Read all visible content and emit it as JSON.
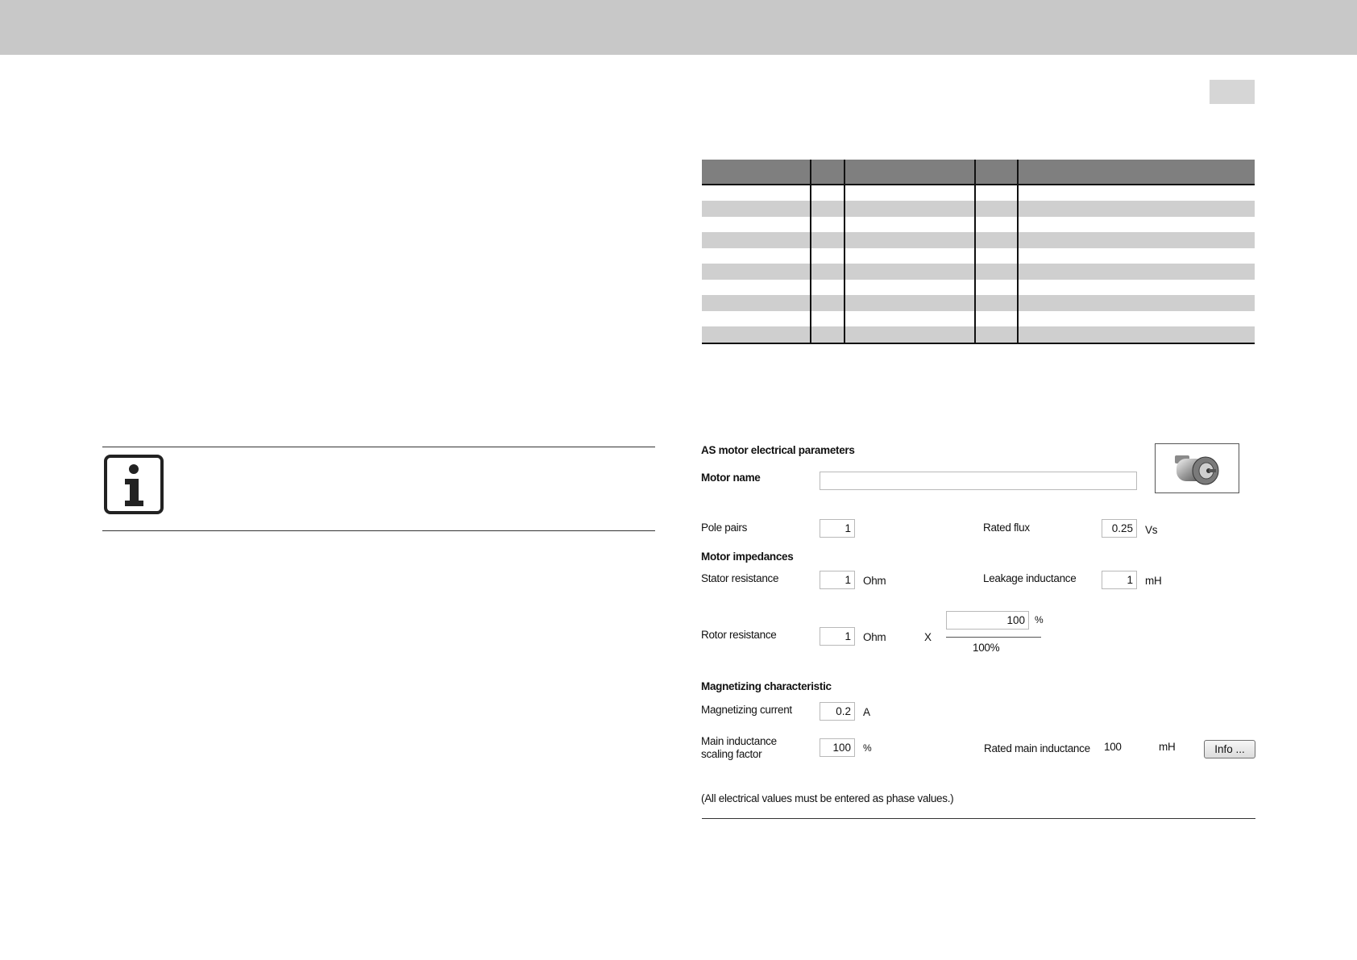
{
  "dialog": {
    "title": "AS motor electrical parameters",
    "motor_name": {
      "label": "Motor name",
      "value": ""
    },
    "pole_pairs": {
      "label": "Pole pairs",
      "value": "1"
    },
    "rated_flux": {
      "label": "Rated flux",
      "value": "0.25",
      "unit": "Vs"
    },
    "impedances_heading": "Motor impedances",
    "stator_resistance": {
      "label": "Stator resistance",
      "value": "1",
      "unit": "Ohm"
    },
    "leakage_inductance": {
      "label": "Leakage inductance",
      "value": "1",
      "unit": "mH"
    },
    "rotor_resistance": {
      "label": "Rotor resistance",
      "value": "1",
      "unit": "Ohm"
    },
    "rotor_factor": {
      "multiply": "X",
      "value": "100",
      "unit": "%",
      "denominator": "100%"
    },
    "magnetizing_heading": "Magnetizing characteristic",
    "magnetizing_current": {
      "label": "Magnetizing current",
      "value": "0.2",
      "unit": "A"
    },
    "main_inductance_scaling": {
      "label_line1": "Main inductance",
      "label_line2": "scaling factor",
      "value": "100",
      "unit": "%"
    },
    "rated_main_inductance": {
      "label": "Rated main inductance",
      "value": "100",
      "unit": "mH"
    },
    "info_button": "Info ...",
    "note": "(All electrical values must be entered as phase values.)"
  },
  "icons": {
    "info": "info-icon",
    "motor": "motor-icon"
  }
}
